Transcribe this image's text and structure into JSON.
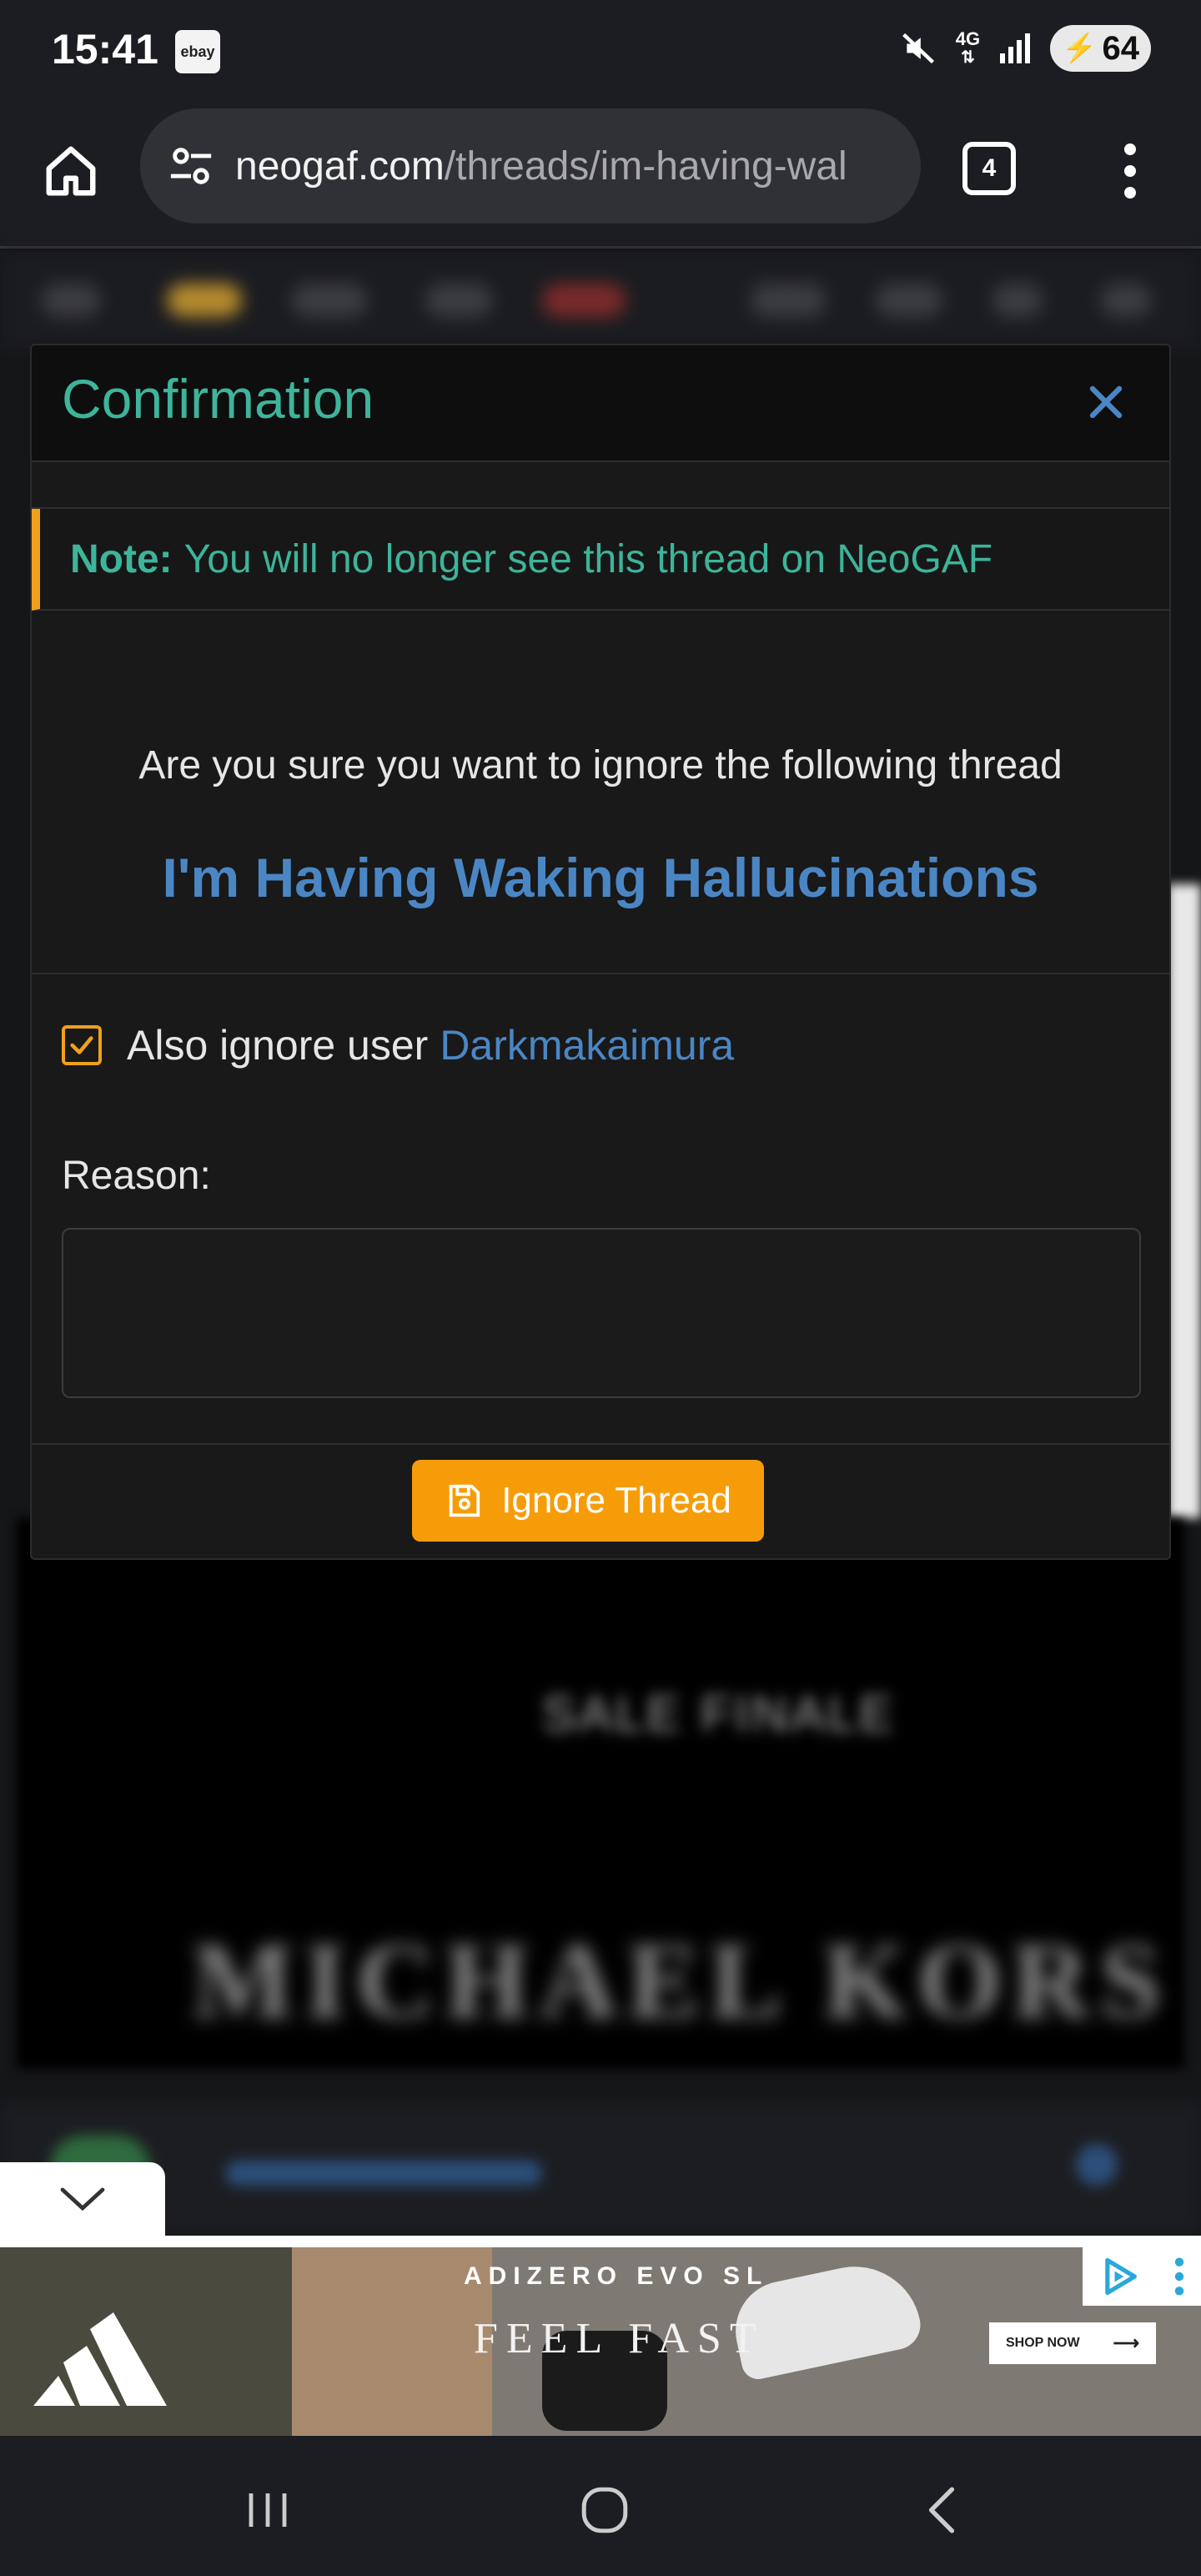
{
  "status_bar": {
    "time": "15:41",
    "app_icon": "ebay",
    "network": "4G",
    "battery": "64",
    "icons": [
      "mute-icon",
      "signal-icon",
      "battery-icon"
    ]
  },
  "browser": {
    "url_domain": "neogaf.com",
    "url_path": "/threads/im-having-wal",
    "tab_count": "4",
    "icons": [
      "home-icon",
      "site-settings-icon",
      "tab-switcher-icon",
      "more-menu-icon"
    ]
  },
  "modal": {
    "title": "Confirmation",
    "note_label": "Note:",
    "note_text": "You will no longer see this thread on NeoGAF",
    "confirm_text": "Are you sure you want to ignore the following thread",
    "thread_title": "I'm Having Waking Hallucinations",
    "also_ignore_label": "Also ignore user",
    "also_ignore_user": "Darkmakaimura",
    "also_ignore_checked": true,
    "reason_label": "Reason:",
    "reason_value": "",
    "submit_label": "Ignore Thread"
  },
  "ad": {
    "headline": "ADIZERO EVO SL",
    "tagline": "FEEL FAST",
    "cta": "SHOP NOW"
  },
  "colors": {
    "accent_teal": "#3eb49a",
    "link_blue": "#4b86c4",
    "warning_orange": "#f79c09",
    "modal_bg": "#191919"
  }
}
